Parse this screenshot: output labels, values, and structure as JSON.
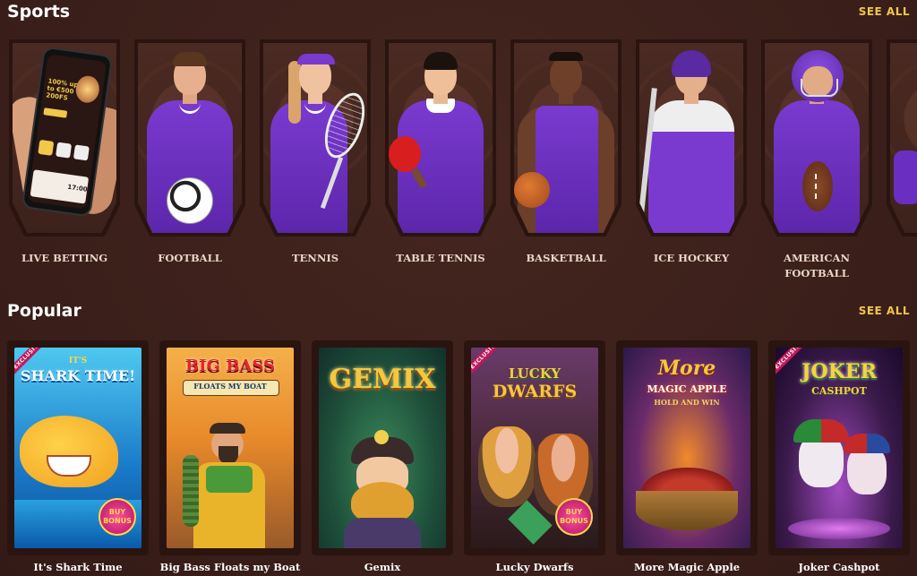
{
  "sports": {
    "title": "Sports",
    "see_all": "SEE ALL",
    "items": [
      {
        "label": "LIVE BETTING",
        "icon": "phone-in-hand"
      },
      {
        "label": "FOOTBALL",
        "icon": "football-player"
      },
      {
        "label": "TENNIS",
        "icon": "tennis-player"
      },
      {
        "label": "TABLE TENNIS",
        "icon": "table-tennis-player"
      },
      {
        "label": "BASKETBALL",
        "icon": "basketball-player"
      },
      {
        "label": "ICE HOCKEY",
        "icon": "ice-hockey-player"
      },
      {
        "label": "AMERICAN FOOTBALL",
        "icon": "american-football-player"
      }
    ],
    "phone": {
      "promo": "100% up to €500 + 200FS",
      "time": "17:00"
    }
  },
  "popular": {
    "title": "Popular",
    "see_all": "SEE ALL",
    "games": [
      {
        "title": "It's Shark Time",
        "logo_top": "IT'S",
        "logo": "SHARK TIME!",
        "exclusive": "EXCLUSIVE",
        "bonus": "BUY BONUS"
      },
      {
        "title": "Big Bass Floats my Boat",
        "logo": "BIG BASS",
        "logo_sub": "FLOATS MY BOAT"
      },
      {
        "title": "Gemix",
        "logo": "GEMIX"
      },
      {
        "title": "Lucky Dwarfs",
        "logo": "LUCKY",
        "logo_sub": "DWARFS",
        "exclusive": "EXCLUSIVE",
        "bonus": "BUY BONUS"
      },
      {
        "title": "More Magic Apple",
        "logo": "More",
        "logo_sub": "MAGIC APPLE",
        "logo_sub2": "HOLD AND WIN"
      },
      {
        "title": "Joker Cashpot",
        "logo": "JOKER",
        "logo_sub": "CASHPOT",
        "exclusive": "EXCLUSIVE"
      }
    ]
  },
  "colors": {
    "background": "#3b1f1a",
    "accent": "#f0c84a",
    "jersey": "#6a2fc0"
  }
}
